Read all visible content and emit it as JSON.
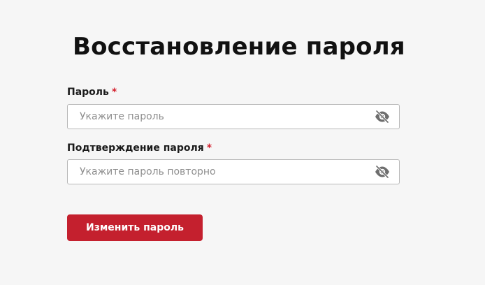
{
  "page": {
    "title": "Восстановление пароля"
  },
  "form": {
    "password": {
      "label": "Пароль",
      "required_mark": "*",
      "placeholder": "Укажите пароль",
      "value": "",
      "toggle_icon": "eye-slash-icon"
    },
    "confirm": {
      "label": "Подтверждение пароля",
      "required_mark": "*",
      "placeholder": "Укажите пароль повторно",
      "value": "",
      "toggle_icon": "eye-slash-icon"
    },
    "submit_label": "Изменить пароль"
  },
  "colors": {
    "accent": "#c4202e",
    "required": "#d4222f",
    "background": "#f6f6f6",
    "input_border": "#b9b9b9"
  }
}
